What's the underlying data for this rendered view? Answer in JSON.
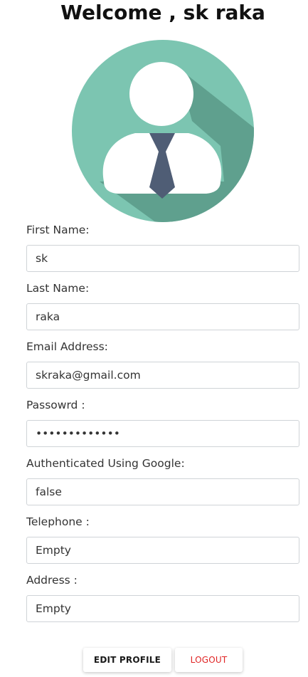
{
  "header": {
    "title": "Welcome , sk raka"
  },
  "avatar": {
    "icon": "user-avatar-icon",
    "colors": {
      "circle": "#7cc5b1",
      "shadow": "#5fa08e",
      "person": "#ffffff",
      "tie": "#4f5d75"
    }
  },
  "form": {
    "first_name": {
      "label": "First Name:",
      "value": "sk"
    },
    "last_name": {
      "label": "Last Name:",
      "value": "raka"
    },
    "email": {
      "label": "Email Address:",
      "value": "skraka@gmail.com"
    },
    "password": {
      "label": "Passowrd :",
      "value": "•••••••••••••"
    },
    "google_auth": {
      "label": "Authenticated Using Google:",
      "value": "false"
    },
    "telephone": {
      "label": "Telephone :",
      "value": "Empty"
    },
    "address": {
      "label": "Address :",
      "value": "Empty"
    }
  },
  "actions": {
    "edit_label": "EDIT PROFILE",
    "logout_label": "LOGOUT",
    "logout_color": "#e02424"
  }
}
